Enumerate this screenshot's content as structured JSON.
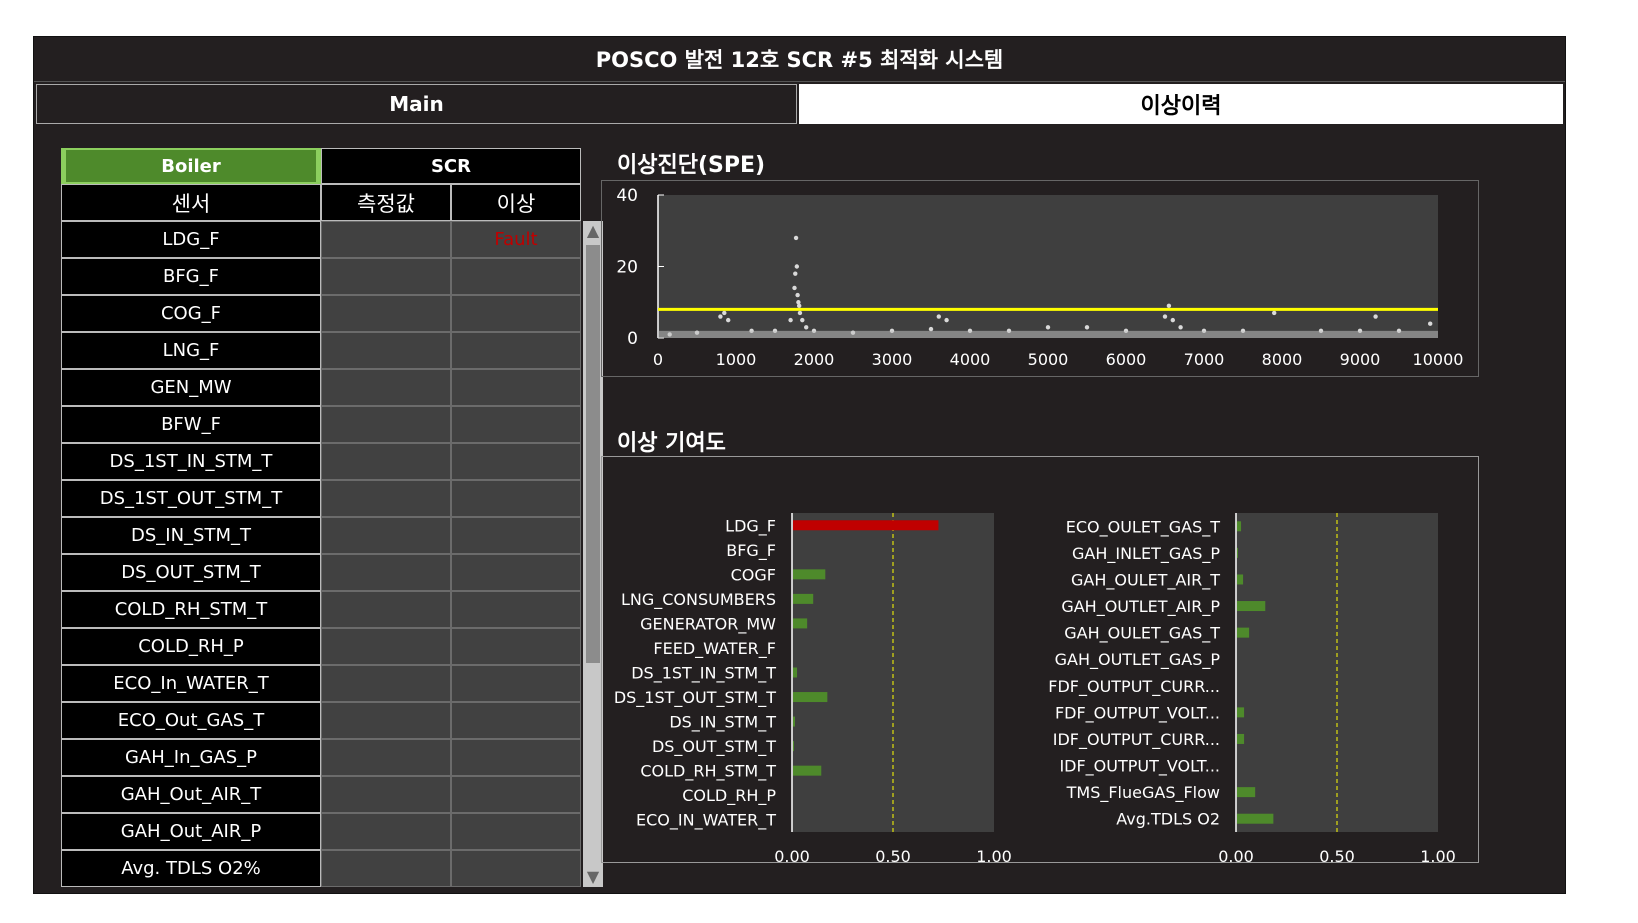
{
  "header": {
    "title": "POSCO 발전 12호 SCR #5 최적화 시스템"
  },
  "tabs": {
    "main": "Main",
    "history": "이상이력"
  },
  "sensor_panel": {
    "subtabs": {
      "boiler": "Boiler",
      "scr": "SCR"
    },
    "columns": {
      "sensor": "센서",
      "value": "측정값",
      "fault": "이상"
    },
    "rows": [
      {
        "name": "LDG_F",
        "fault": "Fault"
      },
      {
        "name": "BFG_F",
        "fault": ""
      },
      {
        "name": "COG_F",
        "fault": ""
      },
      {
        "name": "LNG_F",
        "fault": ""
      },
      {
        "name": "GEN_MW",
        "fault": ""
      },
      {
        "name": "BFW_F",
        "fault": ""
      },
      {
        "name": "DS_1ST_IN_STM_T",
        "fault": ""
      },
      {
        "name": "DS_1ST_OUT_STM_T",
        "fault": ""
      },
      {
        "name": "DS_IN_STM_T",
        "fault": ""
      },
      {
        "name": "DS_OUT_STM_T",
        "fault": ""
      },
      {
        "name": "COLD_RH_STM_T",
        "fault": ""
      },
      {
        "name": "COLD_RH_P",
        "fault": ""
      },
      {
        "name": "ECO_In_WATER_T",
        "fault": ""
      },
      {
        "name": "ECO_Out_GAS_T",
        "fault": ""
      },
      {
        "name": "GAH_In_GAS_P",
        "fault": ""
      },
      {
        "name": "GAH_Out_AIR_T",
        "fault": ""
      },
      {
        "name": "GAH_Out_AIR_P",
        "fault": ""
      },
      {
        "name": "Avg. TDLS O2%",
        "fault": ""
      }
    ]
  },
  "spe_section": {
    "title": "이상진단(SPE)"
  },
  "contrib_section": {
    "title": "이상 기여도"
  },
  "colors": {
    "background": "#231f20",
    "plot_bg": "#3f3f3f",
    "threshold": "#ffff00",
    "bar_normal": "#4e8a2b",
    "bar_fault": "#c00000",
    "fault_text": "#c00000"
  },
  "chart_data": [
    {
      "type": "scatter",
      "title": "이상진단(SPE)",
      "xlim": [
        0,
        10000
      ],
      "ylim": [
        0,
        40
      ],
      "xticks": [
        0,
        1000,
        2000,
        3000,
        4000,
        5000,
        6000,
        7000,
        8000,
        9000,
        10000
      ],
      "yticks": [
        0,
        20,
        40
      ],
      "threshold": 8,
      "series": [
        {
          "x": [
            150,
            500,
            800,
            850,
            900,
            1200,
            1500,
            1700,
            1750,
            1760,
            1770,
            1780,
            1790,
            1800,
            1810,
            1820,
            1850,
            1900,
            2000,
            2500,
            3000,
            3500,
            3600,
            3700,
            4000,
            4500,
            5000,
            5500,
            6000,
            6500,
            6550,
            6600,
            6700,
            7000,
            7500,
            7900,
            8500,
            9000,
            9200,
            9500,
            9900
          ],
          "y": [
            1,
            1.5,
            6,
            7,
            5,
            2,
            2,
            5,
            14,
            18,
            28,
            20,
            12,
            10,
            9,
            7,
            5,
            3,
            2,
            1.5,
            2,
            2.5,
            6,
            5,
            2,
            2,
            3,
            3,
            2,
            6,
            9,
            5,
            3,
            2,
            2,
            7,
            2,
            2,
            6,
            2,
            4
          ]
        }
      ]
    },
    {
      "type": "bar",
      "orientation": "horizontal",
      "xlim": [
        0,
        1.0
      ],
      "xticks": [
        "0.00",
        "0.50",
        "1.00"
      ],
      "threshold": 0.5,
      "categories": [
        "LDG_F",
        "BFG_F",
        "COGF",
        "LNG_CONSUMBERS",
        "GENERATOR_MW",
        "FEED_WATER_F",
        "DS_1ST_IN_STM_T",
        "DS_1ST_OUT_STM_T",
        "DS_IN_STM_T",
        "DS_OUT_STM_T",
        "COLD_RH_STM_T",
        "COLD_RH_P",
        "ECO_IN_WATER_T"
      ],
      "values": [
        0.72,
        0.0,
        0.16,
        0.1,
        0.07,
        0.0,
        0.02,
        0.17,
        0.01,
        0.005,
        0.14,
        0.0,
        0.0
      ],
      "fault_index": 0
    },
    {
      "type": "bar",
      "orientation": "horizontal",
      "xlim": [
        0,
        1.0
      ],
      "xticks": [
        "0.00",
        "0.50",
        "1.00"
      ],
      "threshold": 0.5,
      "categories": [
        "ECO_OULET_GAS_T",
        "GAH_INLET_GAS_P",
        "GAH_OULET_AIR_T",
        "GAH_OUTLET_AIR_P",
        "GAH_OULET_GAS_T",
        "GAH_OUTLET_GAS_P",
        "FDF_OUTPUT_CURR...",
        "FDF_OUTPUT_VOLT...",
        "IDF_OUTPUT_CURR...",
        "IDF_OUTPUT_VOLT...",
        "TMS_FlueGAS_Flow",
        "Avg.TDLS O2"
      ],
      "values": [
        0.02,
        0.005,
        0.03,
        0.14,
        0.06,
        0.0,
        0.0,
        0.035,
        0.035,
        0.0,
        0.09,
        0.18
      ]
    }
  ]
}
